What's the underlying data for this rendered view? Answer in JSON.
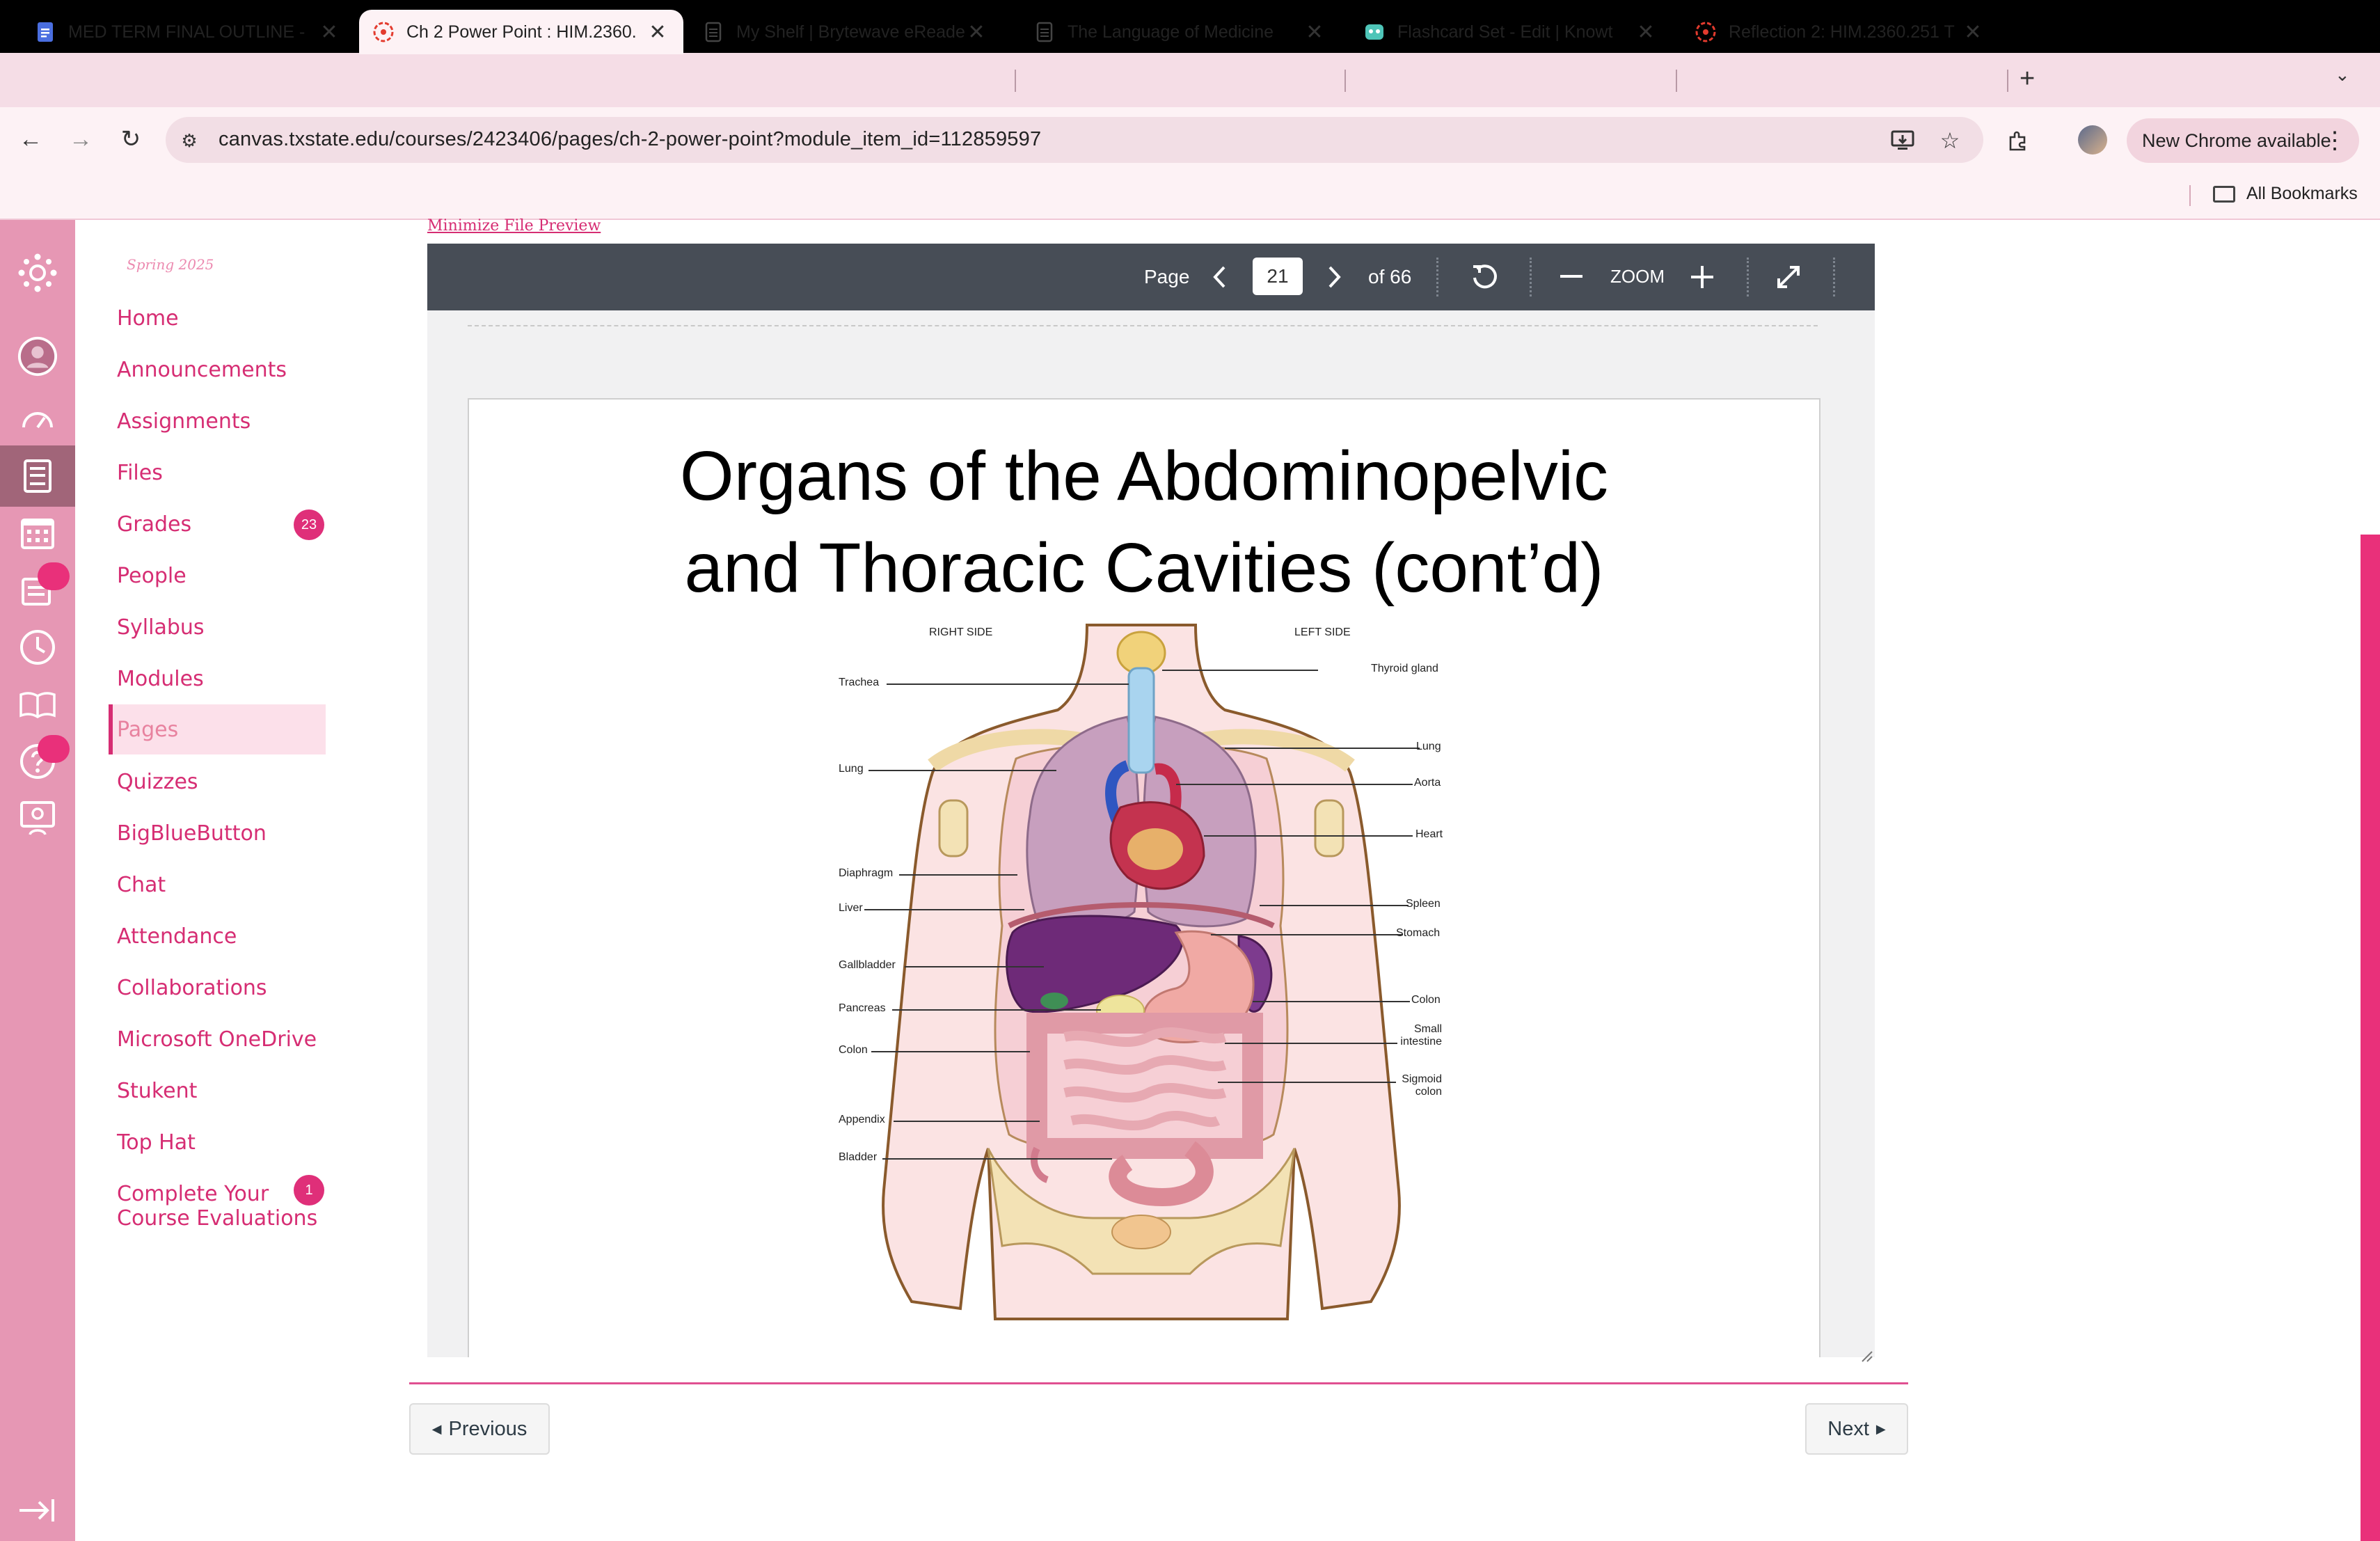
{
  "browser": {
    "tabs": [
      {
        "title": "MED TERM FINAL OUTLINE -",
        "icon": "docs-icon",
        "active": false
      },
      {
        "title": "Ch 2 Power Point : HIM.2360.",
        "icon": "canvas-icon",
        "active": true
      },
      {
        "title": "My Shelf | Brytewave eReader",
        "icon": "page-icon",
        "active": false
      },
      {
        "title": "The Language of Medicine",
        "icon": "page-icon",
        "active": false
      },
      {
        "title": "Flashcard Set - Edit | Knowt",
        "icon": "knowt-icon",
        "active": false
      },
      {
        "title": "Reflection 2: HIM.2360.251 T",
        "icon": "canvas-icon",
        "active": false
      }
    ],
    "url": "canvas.txstate.edu/courses/2423406/pages/ch-2-power-point?module_item_id=112859597",
    "chrome_update": "New Chrome available",
    "bookmarks": "All Bookmarks"
  },
  "course_nav": {
    "term": "Spring 2025",
    "items": [
      {
        "label": "Home"
      },
      {
        "label": "Announcements"
      },
      {
        "label": "Assignments"
      },
      {
        "label": "Files"
      },
      {
        "label": "Grades",
        "count": "23"
      },
      {
        "label": "People"
      },
      {
        "label": "Syllabus"
      },
      {
        "label": "Modules"
      },
      {
        "label": "Pages",
        "active": true
      },
      {
        "label": "Quizzes"
      },
      {
        "label": "BigBlueButton"
      },
      {
        "label": "Chat"
      },
      {
        "label": "Attendance"
      },
      {
        "label": "Collaborations"
      },
      {
        "label": "Microsoft OneDrive"
      },
      {
        "label": "Stukent"
      },
      {
        "label": "Top Hat"
      },
      {
        "label": "Complete Your Course Evaluations",
        "line1": "Complete Your",
        "line2": "Course Evaluations",
        "count": "1"
      }
    ]
  },
  "viewer": {
    "minimize": "Minimize File Preview",
    "page_label": "Page",
    "page": "21",
    "of": "of 66",
    "zoom": "ZOOM"
  },
  "slide": {
    "title_line1": "Organs of the Abdominopelvic",
    "title_line2": "and Thoracic Cavities (cont’d)",
    "figure": {
      "right_side": "RIGHT SIDE",
      "left_side": "LEFT SIDE",
      "labels_left": [
        "Trachea",
        "Lung",
        "Diaphragm",
        "Liver",
        "Gallbladder",
        "Pancreas",
        "Colon",
        "Appendix",
        "Bladder"
      ],
      "labels_right": [
        "Thyroid gland",
        "Lung",
        "Aorta",
        "Heart",
        "Spleen",
        "Stomach",
        "Colon",
        "Small",
        "intestine",
        "Sigmoid",
        "colon"
      ]
    }
  },
  "pager": {
    "previous": "Previous",
    "next": "Next"
  },
  "colors": {
    "canvas_nav": "#e697b4",
    "brand_pink": "#d62d73",
    "toolbar": "#474d56"
  }
}
